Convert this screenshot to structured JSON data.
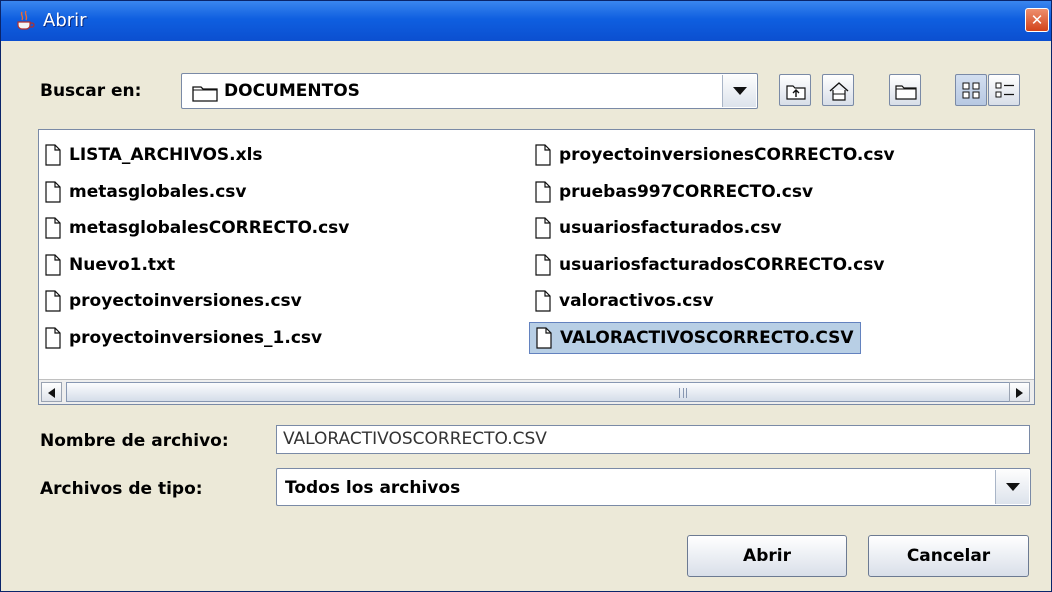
{
  "window": {
    "title": "Abrir",
    "close_glyph": "✕"
  },
  "lookin": {
    "label": "Buscar en:",
    "folder": "DOCUMENTOS",
    "toolbar_icons": [
      "up-folder-icon",
      "home-icon",
      "new-folder-icon",
      "list-view-icon",
      "details-view-icon"
    ]
  },
  "files": [
    {
      "name": "LISTA_ARCHIVOS.xls"
    },
    {
      "name": "metasglobales.csv"
    },
    {
      "name": "metasglobalesCORRECTO.csv"
    },
    {
      "name": "Nuevo1.txt"
    },
    {
      "name": "proyectoinversiones.csv"
    },
    {
      "name": "proyectoinversiones_1.csv"
    },
    {
      "name": "proyectoinversionesCORRECTO.csv"
    },
    {
      "name": "pruebas997CORRECTO.csv"
    },
    {
      "name": "usuariosfacturados.csv"
    },
    {
      "name": "usuariosfacturadosCORRECTO.csv"
    },
    {
      "name": "valoractivos.csv"
    },
    {
      "name": "VALORACTIVOSCORRECTO.CSV",
      "selected": true
    }
  ],
  "filename": {
    "label": "Nombre de archivo:",
    "value": "VALORACTIVOSCORRECTO.CSV"
  },
  "filetype": {
    "label": "Archivos de tipo:",
    "value": "Todos los archivos"
  },
  "buttons": {
    "open": "Abrir",
    "cancel": "Cancelar"
  },
  "colors": {
    "title_bar": "#0f5fe0",
    "selection": "#b8cfe5",
    "dialog_bg": "#ece9d8"
  }
}
